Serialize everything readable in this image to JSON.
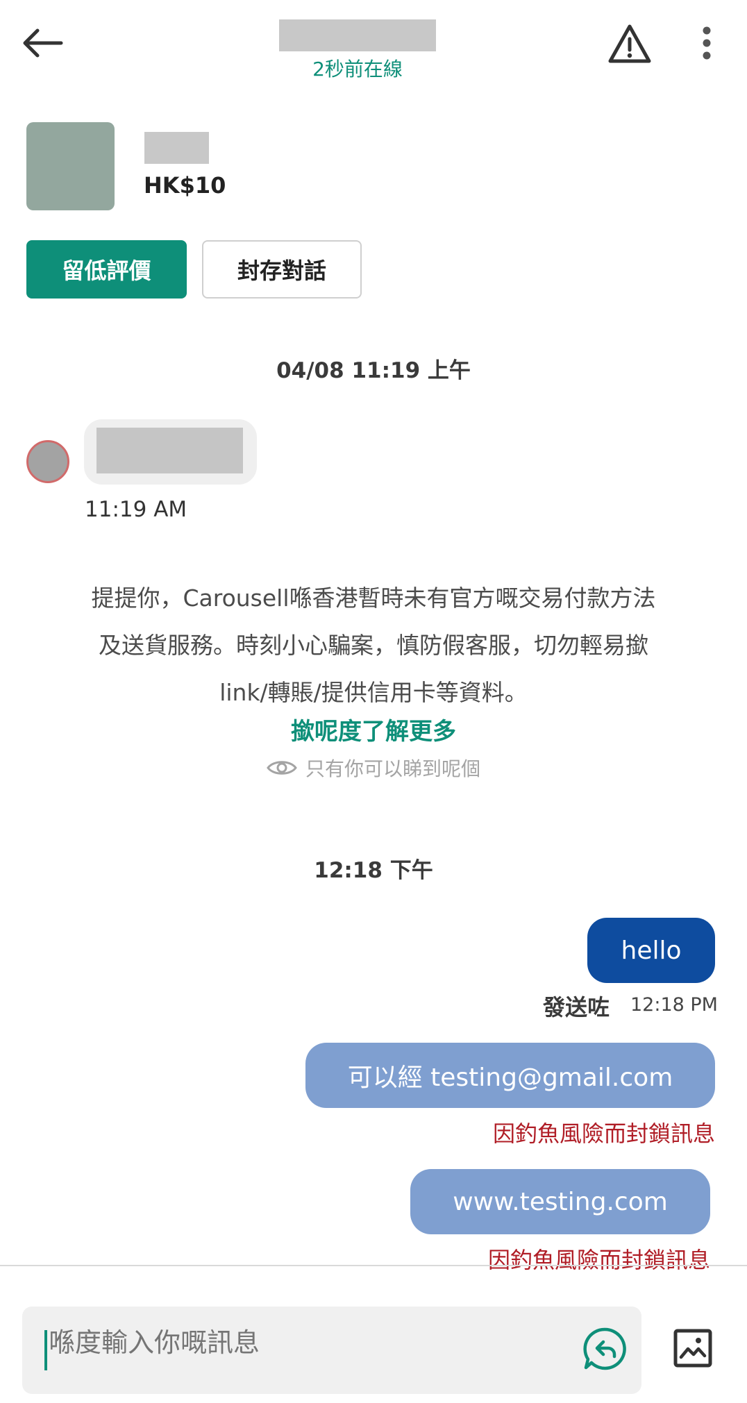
{
  "header": {
    "online_status": "2秒前在線"
  },
  "listing": {
    "price": "HK$10"
  },
  "actions": {
    "review_label": "留低評價",
    "archive_label": "封存對話"
  },
  "conversation": {
    "date_header": "04/08 11:19 上午",
    "received_time": "11:19 AM",
    "notice_line1": "提提你，Carousell喺香港暫時未有官方嘅交易付款方法",
    "notice_line2": "及送貨服務。時刻小心騙案，慎防假客服，切勿輕易撳",
    "notice_line3": "link/轉賬/提供信用卡等資料。",
    "notice_link": "撳呢度了解更多",
    "only_you_label": "只有你可以睇到呢個",
    "time_header_2": "12:18 下午",
    "sent_messages": [
      {
        "text": "hello",
        "status": "發送咗",
        "time": "12:18 PM"
      },
      {
        "text": "可以經 testing@gmail.com",
        "blocked_label": "因釣魚風險而封鎖訊息"
      },
      {
        "text": "www.testing.com",
        "blocked_label": "因釣魚風險而封鎖訊息"
      }
    ]
  },
  "composer": {
    "placeholder": "喺度輸入你嘅訊息"
  },
  "icons": {
    "back": "arrow-left-icon",
    "report": "warning-triangle-icon",
    "more": "more-vertical-icon",
    "visibility": "eye-icon",
    "quick_reply": "reply-bubble-icon",
    "image": "image-icon"
  },
  "colors": {
    "brand_green": "#0e8f79",
    "sent_bubble": "#0e4c9f",
    "blocked_bubble": "#7f9fd0",
    "blocked_text": "#b01d26"
  }
}
